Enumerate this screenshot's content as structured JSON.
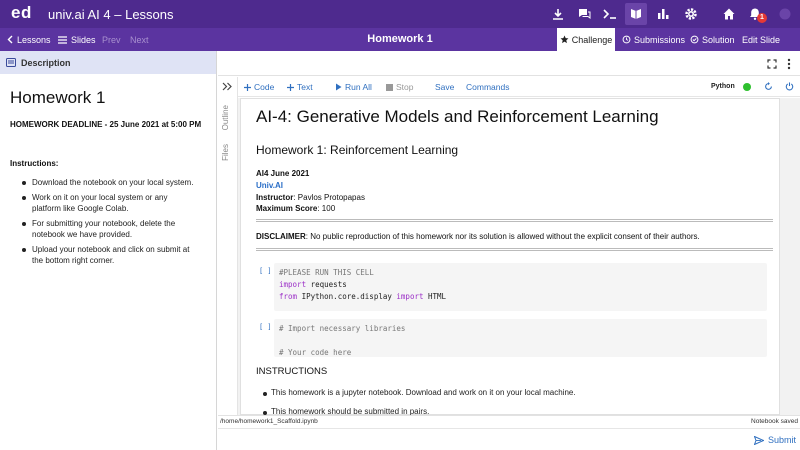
{
  "app": {
    "logo": "ed",
    "course_title": "univ.ai AI 4 – Lessons",
    "notification_count": "1",
    "colors": {
      "brand_dark": "#4e2a8e",
      "brand": "#5b34a0",
      "link": "#3070c0",
      "kernel_ok": "#2ec02e"
    },
    "top_icons": [
      "download-icon",
      "discussion-icon",
      "terminal-icon",
      "lessons-icon",
      "analytics-icon",
      "settings-icon",
      "home-icon",
      "notifications-icon",
      "user-menu-icon"
    ]
  },
  "nav": {
    "lessons_label": "Lessons",
    "slides_label": "Slides",
    "prev_label": "Prev",
    "next_label": "Next",
    "lesson_title": "Homework 1",
    "tabs": {
      "challenge": "Challenge",
      "submissions": "Submissions",
      "solution": "Solution",
      "edit_slide": "Edit Slide"
    }
  },
  "description": {
    "header": "Description",
    "title": "Homework 1",
    "deadline": "HOMEWORK DEADLINE - 25 June 2021 at 5:00 PM",
    "instructions_heading": "Instructions:",
    "items": [
      {
        "lines": [
          "Download the notebook on your local system."
        ]
      },
      {
        "lines": [
          "Work on it on your local system or any",
          "platform like Google Colab."
        ]
      },
      {
        "lines": [
          "For submitting your notebook, delete the",
          "notebook we have provided."
        ]
      },
      {
        "lines": [
          "Upload your notebook and click on submit at",
          "the bottom right corner."
        ]
      }
    ]
  },
  "side_tabs": {
    "outline": "Outline",
    "files": "Files"
  },
  "toolbar": {
    "code": "Code",
    "text": "Text",
    "run_all": "Run All",
    "stop": "Stop",
    "save": "Save",
    "commands": "Commands",
    "kernel": "Python"
  },
  "notebook": {
    "title": "AI-4: Generative Models and Reinforcement Learning",
    "subtitle": "Homework 1: Reinforcement Learning",
    "date": "AI4 June 2021",
    "org": "Univ.AI",
    "instructor_label": "Instructor",
    "instructor_value": ": Pavlos Protopapas",
    "max_score_label": "Maximum Score",
    "max_score_value": ": 100",
    "disclaimer_label": "DISCLAIMER",
    "disclaimer_text": ": No public reproduction of this homework nor its solution is allowed without the explicit consent of their authors.",
    "cell_prompt": "[ ]",
    "cell1": [
      [
        [
          "comment",
          "#PLEASE RUN THIS CELL"
        ]
      ],
      [
        [
          "kw",
          "import"
        ],
        [
          "plain",
          " requests"
        ]
      ],
      [
        [
          "kw",
          "from"
        ],
        [
          "plain",
          " IPython.core.display "
        ],
        [
          "kw",
          "import"
        ],
        [
          "plain",
          " HTML"
        ]
      ]
    ],
    "cell2": [
      [
        [
          "comment",
          "# Import necessary libraries"
        ]
      ],
      [
        [
          "plain",
          " "
        ]
      ],
      [
        [
          "comment",
          "# Your code here"
        ]
      ]
    ],
    "instructions_heading": "INSTRUCTIONS",
    "instructions": [
      "This homework is a jupyter notebook. Download and work on it on your local machine.",
      "This homework should be submitted in pairs."
    ]
  },
  "status": {
    "path": "/home/homework1_Scaffold.ipynb",
    "saved": "Notebook saved"
  },
  "submit_label": "Submit"
}
